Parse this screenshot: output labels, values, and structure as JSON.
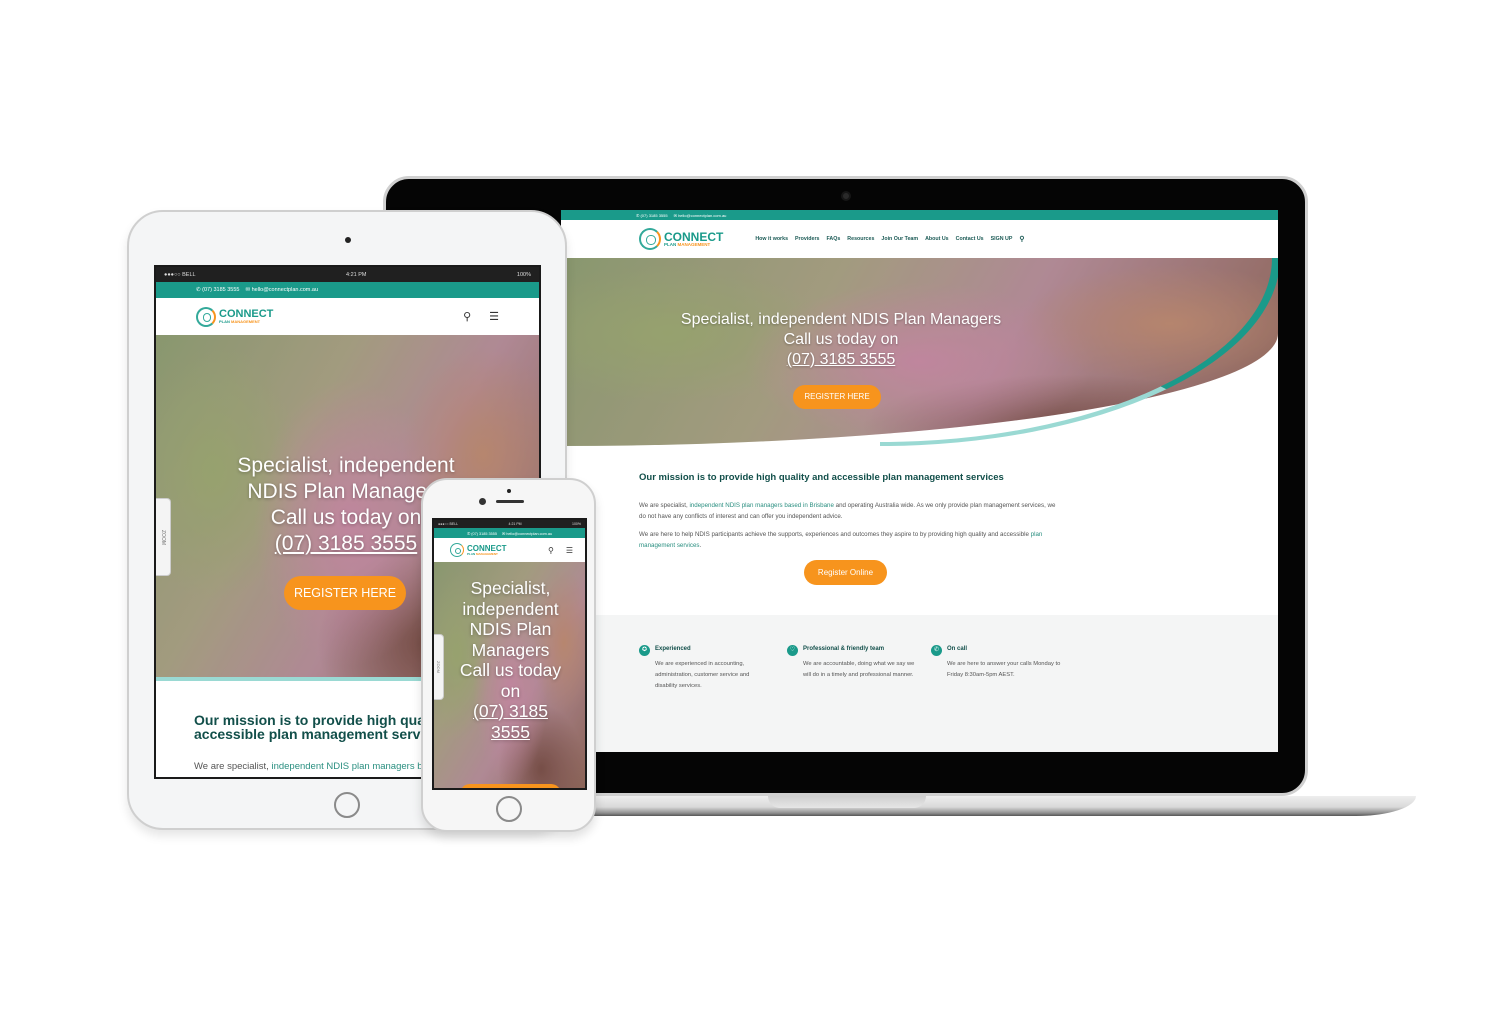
{
  "brand": {
    "name": "CONNECT",
    "sub_plan": "PLAN",
    "sub_management": "MANAGEMENT",
    "colors": {
      "teal": "#1a9a8a",
      "orange": "#f7941d",
      "dark_green": "#124f4a",
      "light_teal": "#9ad9d3"
    }
  },
  "contact": {
    "phone": "(07) 3185 3555",
    "email": "hello@connectplan.com.au"
  },
  "nav": {
    "items": [
      "How it works",
      "Providers",
      "FAQs",
      "Resources",
      "Join Our Team",
      "About Us",
      "Contact Us",
      "SIGN UP"
    ],
    "search_icon": "search-icon",
    "menu_icon": "hamburger-icon"
  },
  "hero": {
    "line1": "Specialist, independent NDIS Plan Managers",
    "line2": "Call us today on",
    "phone": "(07) 3185 3555",
    "button": "REGISTER HERE"
  },
  "tablet_hero": {
    "line1": "Specialist, independent",
    "line2": "NDIS Plan Managers",
    "line3": "Call us today on",
    "phone": "(07) 3185 3555"
  },
  "phone_hero": {
    "line1": "Specialist,",
    "line2": "independent",
    "line3": "NDIS Plan",
    "line4": "Managers",
    "line5": "Call us today",
    "line6": "on",
    "phone1": "(07) 3185",
    "phone2": "3555"
  },
  "mission": {
    "title": "Our mission is to provide high quality and accessible plan management services",
    "tablet_title_line1": "Our mission is to provide high quality and",
    "tablet_title_line2": "accessible plan management services",
    "p1_prefix": "We are specialist, ",
    "p1_link": "independent NDIS plan managers based in Brisbane",
    "p1_suffix": " and operating Australia wide. As we only provide plan management services, we do not have any conflicts of interest and can offer you independent advice.",
    "p2_prefix": "We are here to help NDIS participants achieve the supports, experiences and outcomes they aspire to by providing high quality and accessible ",
    "p2_link": "plan management services",
    "p2_suffix": ".",
    "button": "Register Online"
  },
  "features": [
    {
      "icon": "badge-icon",
      "title": "Experienced",
      "text": "We are experienced in accounting, administration, customer service and disability services."
    },
    {
      "icon": "heart-icon",
      "title": "Professional & friendly team",
      "text": "We are accountable, doing what we say we will do in a timely and professional manner."
    },
    {
      "icon": "phone-icon",
      "title": "On call",
      "text": "We are here to answer your calls Monday to Friday 8:30am-5pm AEST."
    }
  ],
  "device_status": {
    "carrier": "●●●○○ BELL",
    "time": "4:21 PM",
    "battery": "100%",
    "zoom_label": "ZOOM"
  }
}
